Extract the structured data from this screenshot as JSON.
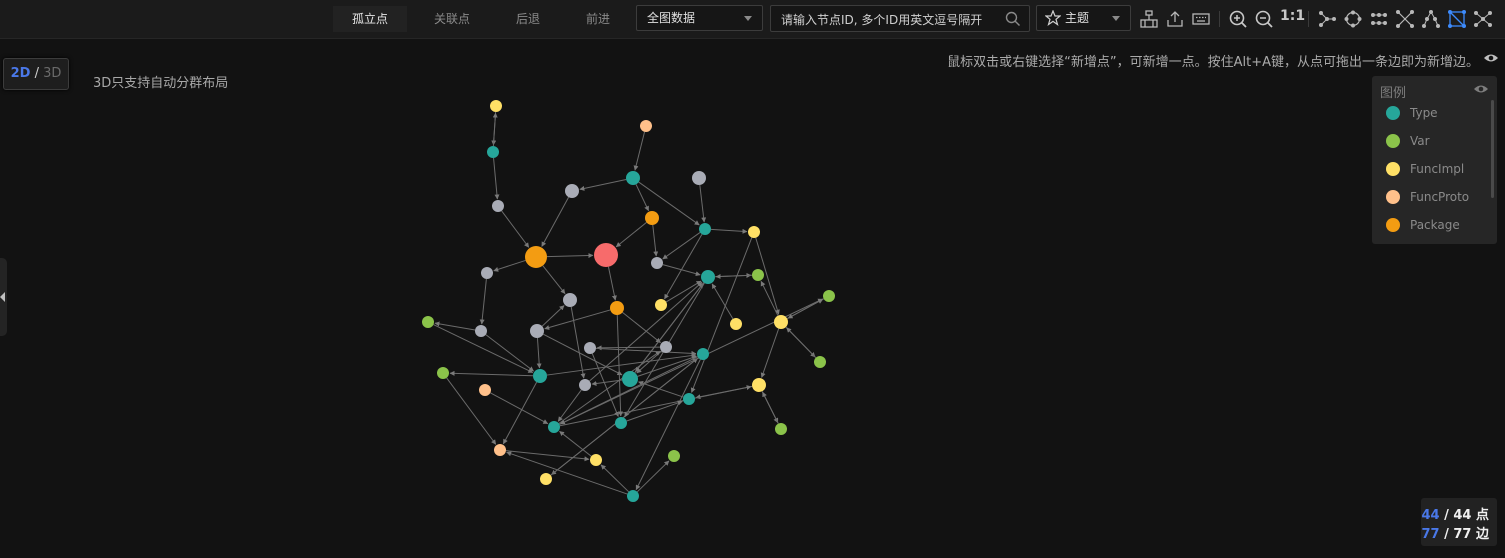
{
  "toolbar": {
    "buttons": [
      "孤立点",
      "关联点",
      "后退",
      "前进"
    ],
    "scope_select": "全图数据",
    "search_placeholder": "请输入节点ID, 多个ID用英文逗号隔开",
    "theme_select": "主题",
    "zoom_ratio": "1:1",
    "icons": [
      "hierarchy-icon",
      "export-icon",
      "keyboard-icon",
      "zoom-in-icon",
      "zoom-out-icon",
      "branch-layout-icon",
      "circular-layout-icon",
      "grid-layout-icon",
      "cross-layout-icon",
      "tree-layout-icon",
      "force-layout-icon",
      "radial-layout-icon"
    ]
  },
  "view_mode": {
    "d2": "2D",
    "sep": "/",
    "d3": "3D",
    "note": "3D只支持自动分群布局"
  },
  "hint": "鼠标双击或右键选择“新增点”，可新增一点。按住Alt+A键，从点可拖出一条边即为新增边。",
  "legend": {
    "title": "图例",
    "items": [
      {
        "label": "Type",
        "color": "#26a69a"
      },
      {
        "label": "Var",
        "color": "#8bc34a"
      },
      {
        "label": "FuncImpl",
        "color": "#ffe066"
      },
      {
        "label": "FuncProto",
        "color": "#ffc08a"
      },
      {
        "label": "Package",
        "color": "#f39c12"
      }
    ]
  },
  "stats": {
    "nodes_shown": "44",
    "nodes_total": "/ 44 点",
    "edges_shown": "77",
    "edges_total": "/ 77 边"
  },
  "colors": {
    "Type": "#26a69a",
    "Var": "#8bc34a",
    "FuncImpl": "#ffe066",
    "FuncProto": "#ffc08a",
    "Package": "#f39c12",
    "Unknown": "#a9acb6",
    "Root": "#f76b6b",
    "edge": "#6b6b6b",
    "accent": "#4a78e8"
  },
  "graph": {
    "nodes": [
      {
        "id": "n1",
        "t": "FuncImpl"
      },
      {
        "id": "n2",
        "t": "Type"
      },
      {
        "id": "n3",
        "t": "Unknown"
      },
      {
        "id": "n4",
        "t": "FuncProto"
      },
      {
        "id": "n5",
        "t": "Type"
      },
      {
        "id": "n6",
        "t": "Unknown"
      },
      {
        "id": "n7",
        "t": "Unknown"
      },
      {
        "id": "n8",
        "t": "Package"
      },
      {
        "id": "n9",
        "t": "Package"
      },
      {
        "id": "n10",
        "t": "Root"
      },
      {
        "id": "n11",
        "t": "Type"
      },
      {
        "id": "n12",
        "t": "FuncImpl"
      },
      {
        "id": "n13",
        "t": "Unknown"
      },
      {
        "id": "n14",
        "t": "Unknown"
      },
      {
        "id": "n15",
        "t": "Type"
      },
      {
        "id": "n16",
        "t": "Var"
      },
      {
        "id": "n17",
        "t": "Unknown"
      },
      {
        "id": "n18",
        "t": "Package"
      },
      {
        "id": "n19",
        "t": "Unknown"
      },
      {
        "id": "n20",
        "t": "Var"
      },
      {
        "id": "n21",
        "t": "Var"
      },
      {
        "id": "n22",
        "t": "Type"
      },
      {
        "id": "n23",
        "t": "Unknown"
      },
      {
        "id": "n24",
        "t": "FuncImpl"
      },
      {
        "id": "n25",
        "t": "FuncImpl"
      },
      {
        "id": "n26",
        "t": "Unknown"
      },
      {
        "id": "n27",
        "t": "Unknown"
      },
      {
        "id": "n28",
        "t": "Type"
      },
      {
        "id": "n29",
        "t": "Var"
      },
      {
        "id": "n30",
        "t": "FuncImpl"
      },
      {
        "id": "n31",
        "t": "Type"
      },
      {
        "id": "n32",
        "t": "FuncProto"
      },
      {
        "id": "n33",
        "t": "Unknown"
      },
      {
        "id": "n34",
        "t": "Type"
      },
      {
        "id": "n35",
        "t": "FuncImpl"
      },
      {
        "id": "n36",
        "t": "Type"
      },
      {
        "id": "n37",
        "t": "Var"
      },
      {
        "id": "n38",
        "t": "Type"
      },
      {
        "id": "n39",
        "t": "Var"
      },
      {
        "id": "n40",
        "t": "FuncImpl"
      },
      {
        "id": "n41",
        "t": "FuncProto"
      },
      {
        "id": "n42",
        "t": "Var"
      },
      {
        "id": "n43",
        "t": "FuncImpl"
      },
      {
        "id": "n44",
        "t": "Type"
      }
    ],
    "edges": [
      [
        "n1",
        "n2"
      ],
      [
        "n2",
        "n1"
      ],
      [
        "n4",
        "n5"
      ],
      [
        "n2",
        "n3"
      ],
      [
        "n3",
        "n8"
      ],
      [
        "n6",
        "n8"
      ],
      [
        "n5",
        "n6"
      ],
      [
        "n8",
        "n10"
      ],
      [
        "n9",
        "n10"
      ],
      [
        "n5",
        "n9"
      ],
      [
        "n5",
        "n11"
      ],
      [
        "n7",
        "n11"
      ],
      [
        "n11",
        "n12"
      ],
      [
        "n11",
        "n13"
      ],
      [
        "n9",
        "n13"
      ],
      [
        "n13",
        "n15"
      ],
      [
        "n10",
        "n18"
      ],
      [
        "n8",
        "n14"
      ],
      [
        "n8",
        "n19"
      ],
      [
        "n14",
        "n17"
      ],
      [
        "n17",
        "n16"
      ],
      [
        "n16",
        "n22"
      ],
      [
        "n17",
        "n22"
      ],
      [
        "n22",
        "n20"
      ],
      [
        "n20",
        "n41"
      ],
      [
        "n22",
        "n41"
      ],
      [
        "n18",
        "n27"
      ],
      [
        "n18",
        "n23"
      ],
      [
        "n23",
        "n19"
      ],
      [
        "n27",
        "n28"
      ],
      [
        "n27",
        "n26"
      ],
      [
        "n26",
        "n36"
      ],
      [
        "n23",
        "n28"
      ],
      [
        "n28",
        "n15"
      ],
      [
        "n25",
        "n15"
      ],
      [
        "n11",
        "n24"
      ],
      [
        "n24",
        "n15"
      ],
      [
        "n15",
        "n21"
      ],
      [
        "n21",
        "n15"
      ],
      [
        "n30",
        "n21"
      ],
      [
        "n30",
        "n29"
      ],
      [
        "n29",
        "n30"
      ],
      [
        "n30",
        "n37"
      ],
      [
        "n37",
        "n30"
      ],
      [
        "n30",
        "n35"
      ],
      [
        "n35",
        "n39"
      ],
      [
        "n39",
        "n35"
      ],
      [
        "n35",
        "n34"
      ],
      [
        "n34",
        "n28"
      ],
      [
        "n28",
        "n33"
      ],
      [
        "n28",
        "n31"
      ],
      [
        "n33",
        "n15"
      ],
      [
        "n23",
        "n22"
      ],
      [
        "n22",
        "n31"
      ],
      [
        "n31",
        "n43"
      ],
      [
        "n43",
        "n31"
      ],
      [
        "n31",
        "n44"
      ],
      [
        "n44",
        "n42"
      ],
      [
        "n32",
        "n38"
      ],
      [
        "n38",
        "n27"
      ],
      [
        "n38",
        "n35"
      ],
      [
        "n40",
        "n38"
      ],
      [
        "n38",
        "n29"
      ],
      [
        "n41",
        "n40"
      ],
      [
        "n22",
        "n45x"
      ],
      [
        "n19",
        "n33"
      ],
      [
        "n36",
        "n34"
      ],
      [
        "n15",
        "n28"
      ],
      [
        "n44",
        "n40"
      ],
      [
        "n18",
        "n36"
      ],
      [
        "n31",
        "n38"
      ],
      [
        "n12",
        "n34"
      ],
      [
        "n33",
        "n38"
      ],
      [
        "n26",
        "n31"
      ],
      [
        "n15",
        "n36"
      ],
      [
        "n44",
        "n41"
      ],
      [
        "n12",
        "n30"
      ]
    ]
  }
}
